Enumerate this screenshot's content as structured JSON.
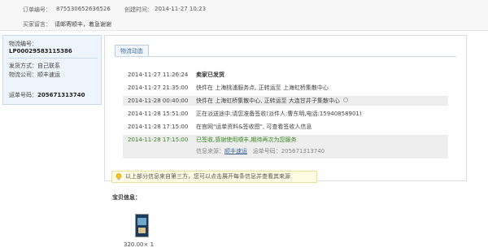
{
  "order": {
    "number_label": "订单编号：",
    "number": "87553065263652​6",
    "created_label": "创建时间：",
    "created": "2014-11-27 10:23",
    "message_label": "买家留言：",
    "message": "请邮寄顺丰，着急谢谢"
  },
  "logistics": {
    "no_label": "物流编号：",
    "no": "LP00029583115386",
    "ship_method_label": "发货方式：",
    "ship_method": "自己联系",
    "company_label": "物流公司：",
    "company": "顺丰速运",
    "waybill_label": "运单号码：",
    "waybill": "205671313740"
  },
  "tab_label": "物流动态",
  "tracking": [
    {
      "date": "2014-11-27 11:26:24",
      "desc": "卖家已发货"
    },
    {
      "date": "2014-11-27 21:35:00",
      "desc": "快件在 上海桃浦服务点, 正转运至 上海虹桥集散中心"
    },
    {
      "date": "2014-11-28 00:40:00",
      "desc": "快件在 上海虹桥集散中心, 正转运至 大连甘井子集散中心"
    },
    {
      "date": "2014-11-28 15:51:00",
      "desc": "正在派送途中,请您准备签收(派件人:曹东明,电话:15940858901)"
    },
    {
      "date": "2014-11-28 17:15:00",
      "desc": "在官网\"运单资料&签收图\", 可查看签收人信息"
    }
  ],
  "latest": {
    "date": "2014-11-28 17:15:00",
    "desc": "已签收,感谢使用顺丰,期待再次为您服务",
    "source_label": "信息来源：",
    "source": "顺丰速运",
    "waybill_label": "运单号码：",
    "waybill": "205671313740"
  },
  "notice": "以上部分信息来自第三方，您可以点击展开每条信息并查看其来源",
  "items_title": "宝贝信息：",
  "item_price": "320.00× 1"
}
